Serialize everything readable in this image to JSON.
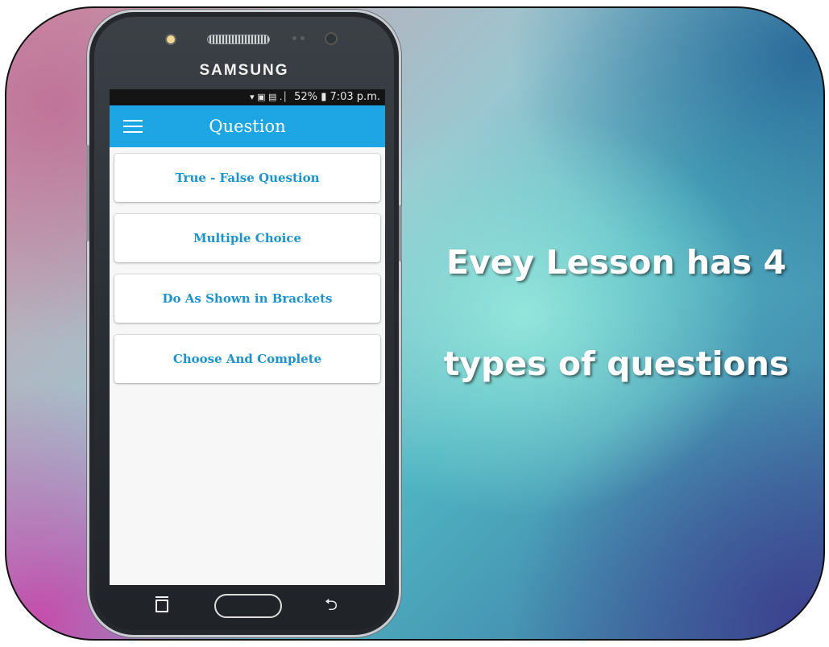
{
  "phone": {
    "brand": "SAMSUNG",
    "status_bar": {
      "battery": "52%",
      "time": "7:03 p.m."
    }
  },
  "app": {
    "title": "Question",
    "question_types": [
      {
        "label": "True - False Question"
      },
      {
        "label": "Multiple Choice"
      },
      {
        "label": "Do As Shown in Brackets"
      },
      {
        "label": "Choose And Complete"
      }
    ]
  },
  "promo": {
    "line1": "Evey Lesson has 4",
    "line2": "types of questions"
  },
  "colors": {
    "app_bar": "#1ea5e3",
    "button_text": "#1b93cf"
  }
}
